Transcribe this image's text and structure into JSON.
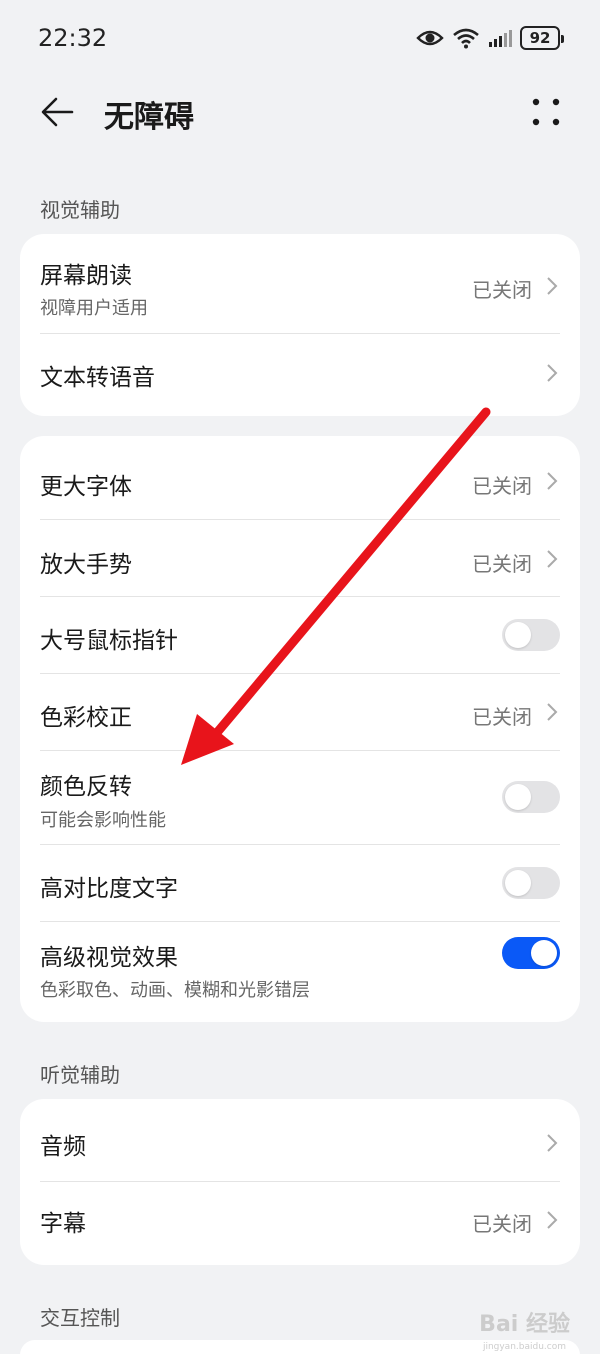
{
  "status_bar": {
    "time": "22:32",
    "battery": "92"
  },
  "app_bar": {
    "title": "无障碍"
  },
  "sections": {
    "visual": "视觉辅助",
    "hearing": "听觉辅助",
    "interaction": "交互控制"
  },
  "card1": {
    "screen_reader": {
      "title": "屏幕朗读",
      "sub": "视障用户适用",
      "value": "已关闭"
    },
    "tts": {
      "title": "文本转语音"
    }
  },
  "card2": {
    "larger_font": {
      "title": "更大字体",
      "value": "已关闭"
    },
    "magnify": {
      "title": "放大手势",
      "value": "已关闭"
    },
    "large_pointer": {
      "title": "大号鼠标指针",
      "on": false
    },
    "color_correction": {
      "title": "色彩校正",
      "value": "已关闭"
    },
    "color_inversion": {
      "title": "颜色反转",
      "sub": "可能会影响性能",
      "on": false
    },
    "high_contrast": {
      "title": "高对比度文字",
      "on": false
    },
    "advanced_visual": {
      "title": "高级视觉效果",
      "sub": "色彩取色、动画、模糊和光影错层",
      "on": true
    }
  },
  "card3": {
    "audio": {
      "title": "音频"
    },
    "captions": {
      "title": "字幕",
      "value": "已关闭"
    }
  },
  "watermark": {
    "text": "Bai  经验",
    "sub": "jingyan.baidu.com"
  },
  "colors": {
    "accent": "#0a59f7",
    "arrow": "#e8141b",
    "background": "#f1f2f4"
  }
}
